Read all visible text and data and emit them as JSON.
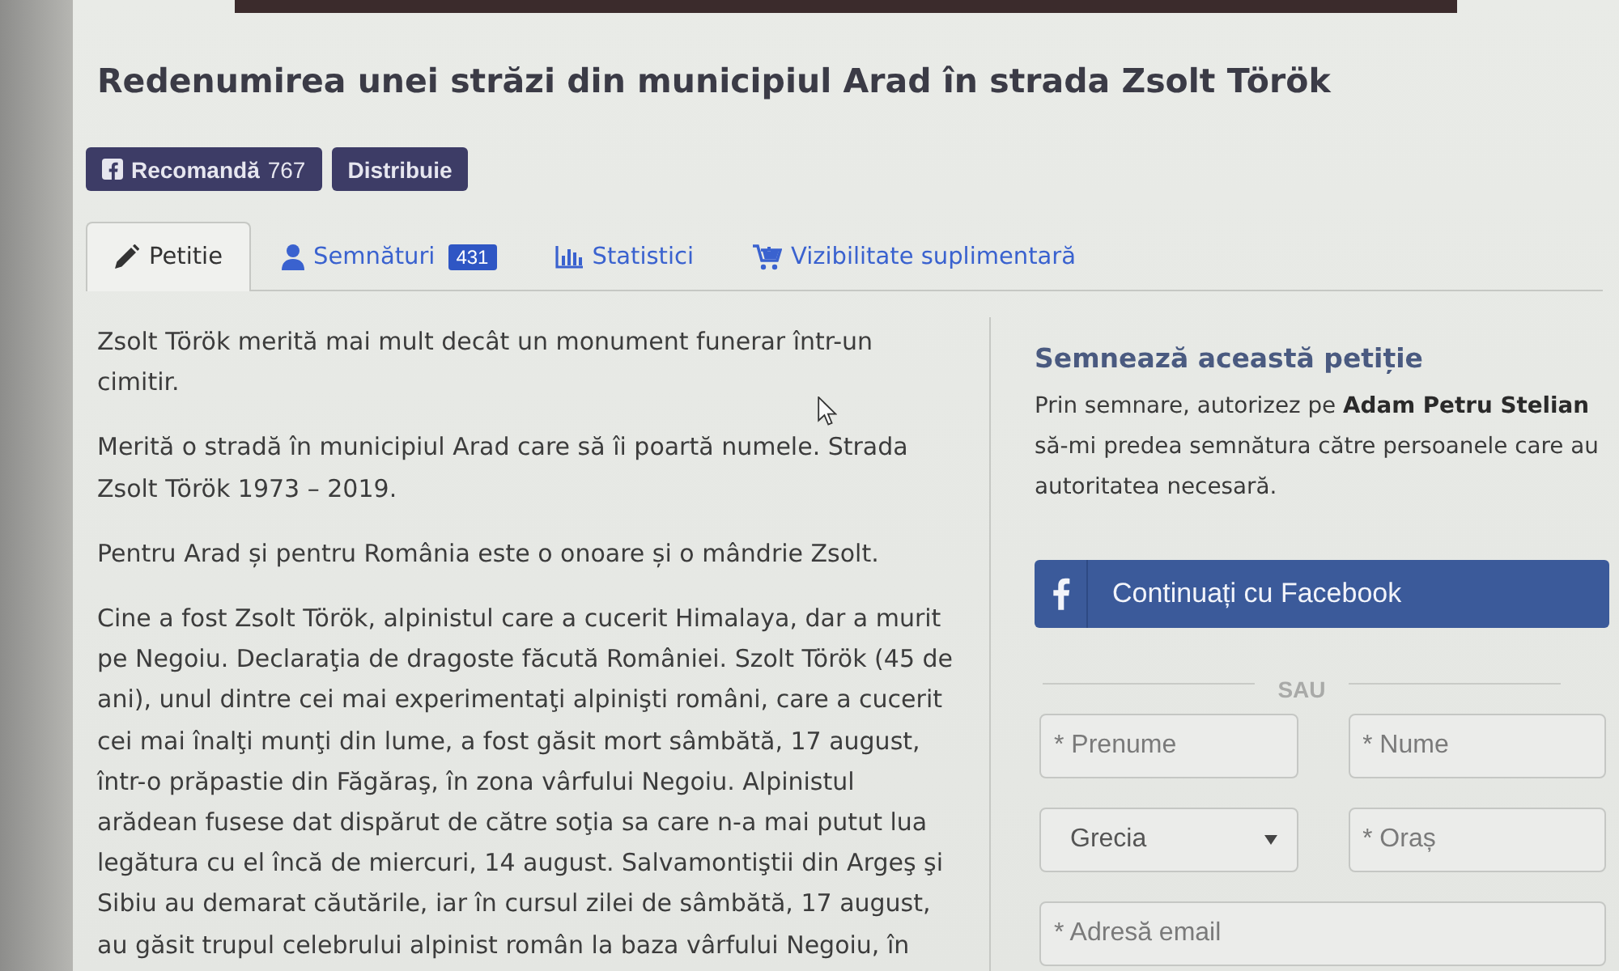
{
  "title": "Redenumirea unei străzi din municipiul Arad în strada Zsolt Török",
  "share_buttons": [
    {
      "kind": "facebook",
      "label": "Recomandă",
      "count": "767"
    },
    {
      "kind": "share",
      "label": "Distribuie"
    }
  ],
  "tabs": [
    {
      "label": "Petitie",
      "selected": true
    },
    {
      "label": "Semnături",
      "badge": "431",
      "selected": false
    },
    {
      "label": "Statistici",
      "selected": false
    },
    {
      "label": "Vizibilitate suplimentară",
      "selected": false
    }
  ],
  "petition_text": {
    "paragraphs": [
      "Zsolt Török merită mai mult decât un monument funerar într-un cimitir.",
      "Merită o stradă în municipiul Arad care să îi poartă numele. Strada Zsolt Török 1973 – 2019.",
      "Pentru Arad și pentru România este o onoare și o mândrie Zsolt.",
      "Cine a fost Zsolt Török, alpinistul care a cucerit Himalaya, dar a murit pe Negoiu. Declaraţia de dragoste făcută României. Szolt Török (45 de ani), unul dintre cei mai experimentaţi alpinişti români, care a cucerit cei mai înalţi munţi din lume, a fost găsit mort sâmbătă, 17 august, într-o prăpastie din Făgăraş, în zona vârfului Negoiu. Alpinistul arădean fusese dat dispărut de către soţia sa care n-a mai putut lua legătura cu el încă de miercuri, 14 august. Salvamontiştii din Argeş şi Sibiu au demarat căutările, iar în cursul zilei de sâmbătă, 17 august, au găsit trupul celebrului alpinist român la baza vârfului Negoiu, în"
    ]
  },
  "sign_panel": {
    "heading": "Semnează această petiție",
    "text": "Prin semnare, autorizez pe **Adam Petru Stelian** să-mi predea semnătura către persoanele care au autoritatea necesară.",
    "facebook_button": "Continuați cu Facebook",
    "divider": "SAU",
    "fields": [
      {
        "kind": "text",
        "placeholder": "* Prenume"
      },
      {
        "kind": "text",
        "placeholder": "* Nume"
      },
      {
        "kind": "select",
        "value": "Grecia"
      },
      {
        "kind": "text",
        "placeholder": "* Oraș"
      },
      {
        "kind": "wide",
        "placeholder": "* Adresă email"
      }
    ]
  }
}
